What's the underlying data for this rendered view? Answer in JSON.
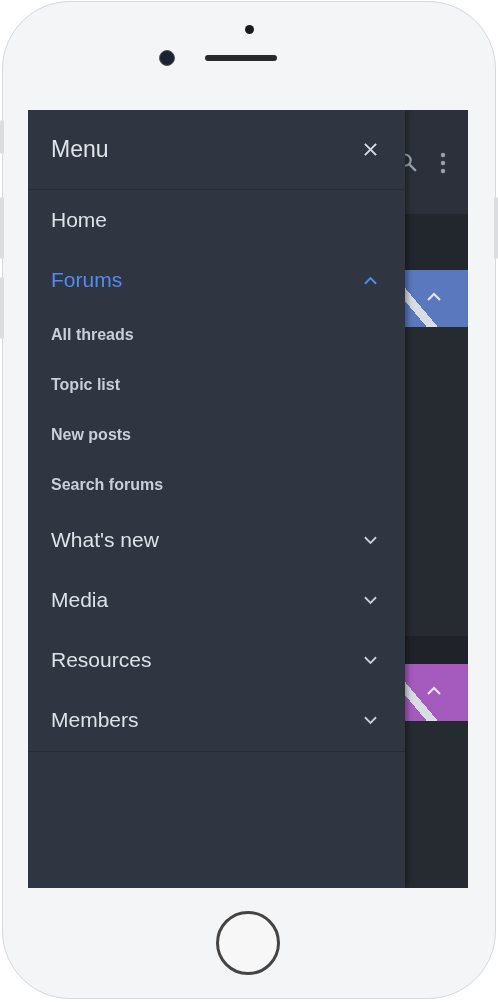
{
  "menu": {
    "title": "Menu",
    "items": [
      {
        "label": "Home",
        "kind": "link",
        "selected": false
      },
      {
        "label": "Forums",
        "kind": "expandable",
        "selected": true,
        "expanded": true,
        "children": [
          {
            "label": "All threads"
          },
          {
            "label": "Topic list"
          },
          {
            "label": "New posts"
          },
          {
            "label": "Search forums"
          }
        ]
      },
      {
        "label": "What's new",
        "kind": "expandable",
        "selected": false,
        "expanded": false
      },
      {
        "label": "Media",
        "kind": "expandable",
        "selected": false,
        "expanded": false
      },
      {
        "label": "Resources",
        "kind": "expandable",
        "selected": false,
        "expanded": false
      },
      {
        "label": "Members",
        "kind": "expandable",
        "selected": false,
        "expanded": false
      }
    ]
  },
  "background_blocks": [
    {
      "color": "#5a78bd"
    },
    {
      "color": "#a55bbd"
    }
  ]
}
